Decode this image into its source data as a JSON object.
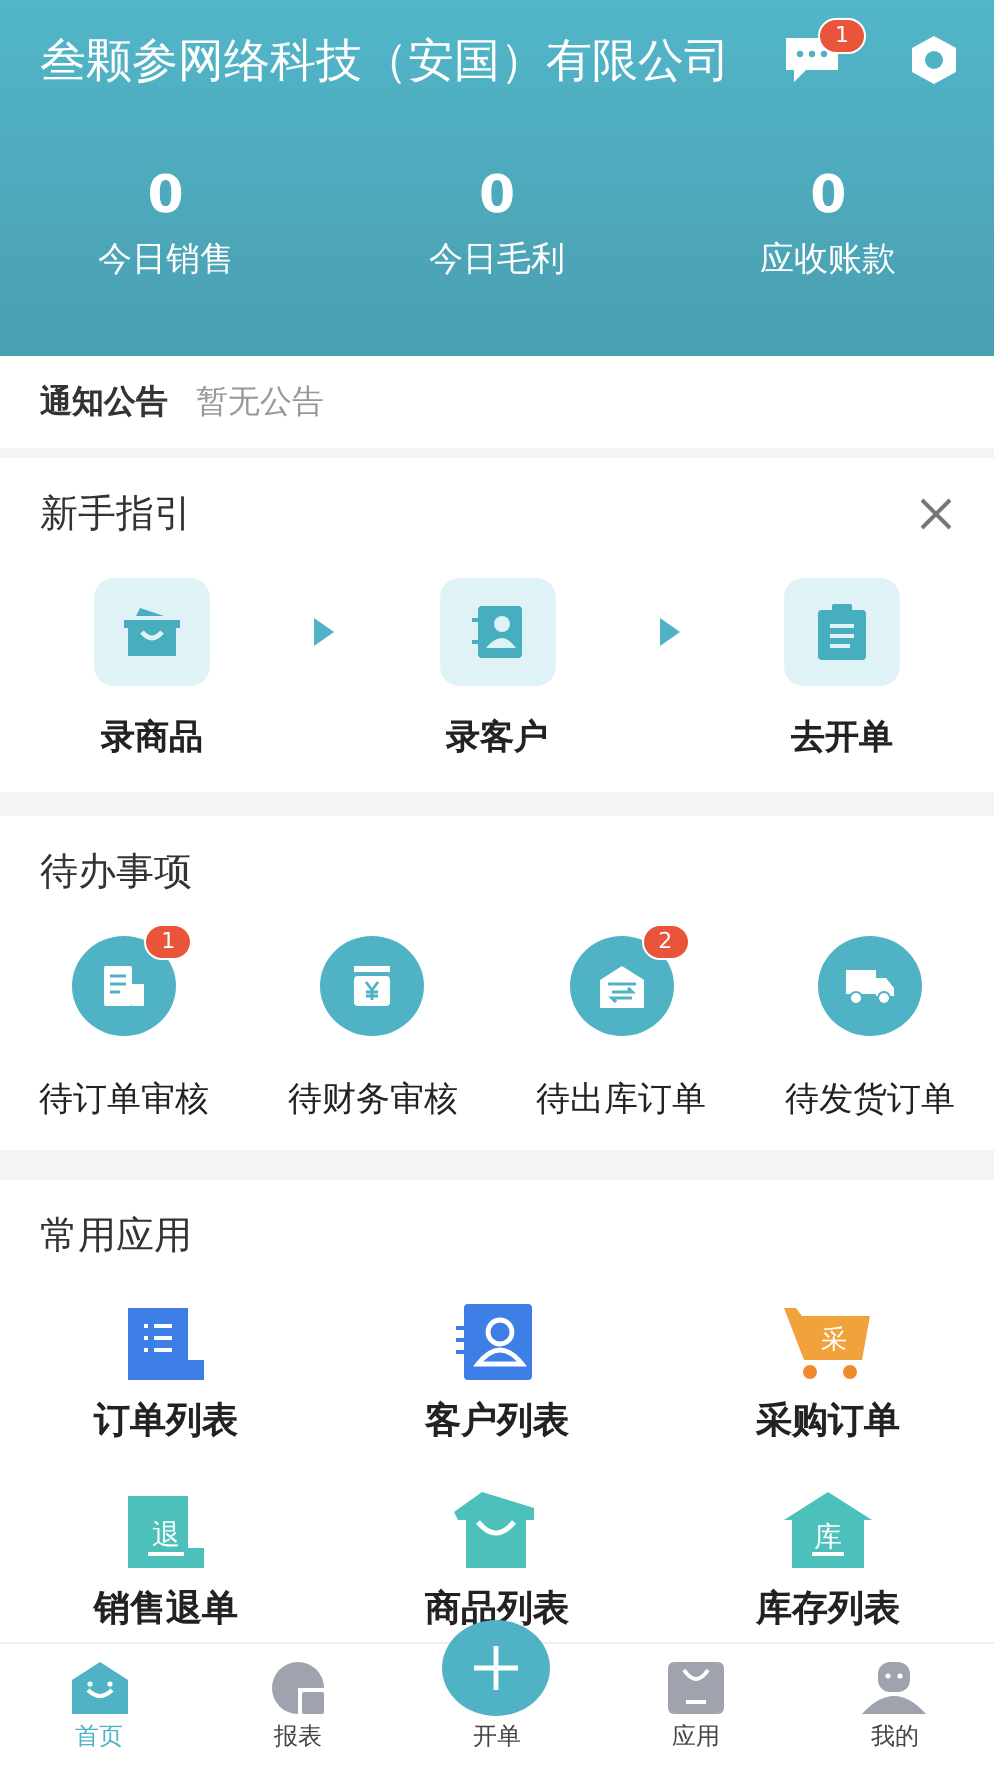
{
  "header": {
    "title": "叁颗参网络科技（安国）有限公司",
    "message_badge": "1"
  },
  "stats": [
    {
      "value": "0",
      "label": "今日销售"
    },
    {
      "value": "0",
      "label": "今日毛利"
    },
    {
      "value": "0",
      "label": "应收账款"
    }
  ],
  "notice": {
    "label": "通知公告",
    "text": "暂无公告"
  },
  "guide": {
    "title": "新手指引",
    "steps": [
      {
        "kind": "goods",
        "label": "录商品"
      },
      {
        "kind": "customer",
        "label": "录客户"
      },
      {
        "kind": "order",
        "label": "去开单"
      }
    ]
  },
  "todo": {
    "title": "待办事项",
    "items": [
      {
        "kind": "order",
        "label": "待订单审核",
        "badge": "1"
      },
      {
        "kind": "finance",
        "label": "待财务审核"
      },
      {
        "kind": "warehouse",
        "label": "待出库订单",
        "badge": "2"
      },
      {
        "kind": "truck",
        "label": "待发货订单"
      }
    ]
  },
  "apps": {
    "title": "常用应用",
    "items": [
      {
        "kind": "list",
        "label": "订单列表"
      },
      {
        "kind": "contact",
        "label": "客户列表"
      },
      {
        "kind": "cart",
        "label": "采购订单",
        "icon_text": "采"
      },
      {
        "kind": "return",
        "label": "销售退单",
        "icon_text": "退"
      },
      {
        "kind": "bag",
        "label": "商品列表"
      },
      {
        "kind": "house",
        "label": "库存列表",
        "icon_text": "库"
      }
    ]
  },
  "nav": [
    {
      "kind": "home",
      "label": "首页",
      "selected": true
    },
    {
      "kind": "report",
      "label": "报表",
      "selected": false
    },
    {
      "kind": "plus",
      "label": "开单",
      "selected": false
    },
    {
      "kind": "apps",
      "label": "应用",
      "selected": false
    },
    {
      "kind": "me",
      "label": "我的",
      "selected": false
    }
  ]
}
